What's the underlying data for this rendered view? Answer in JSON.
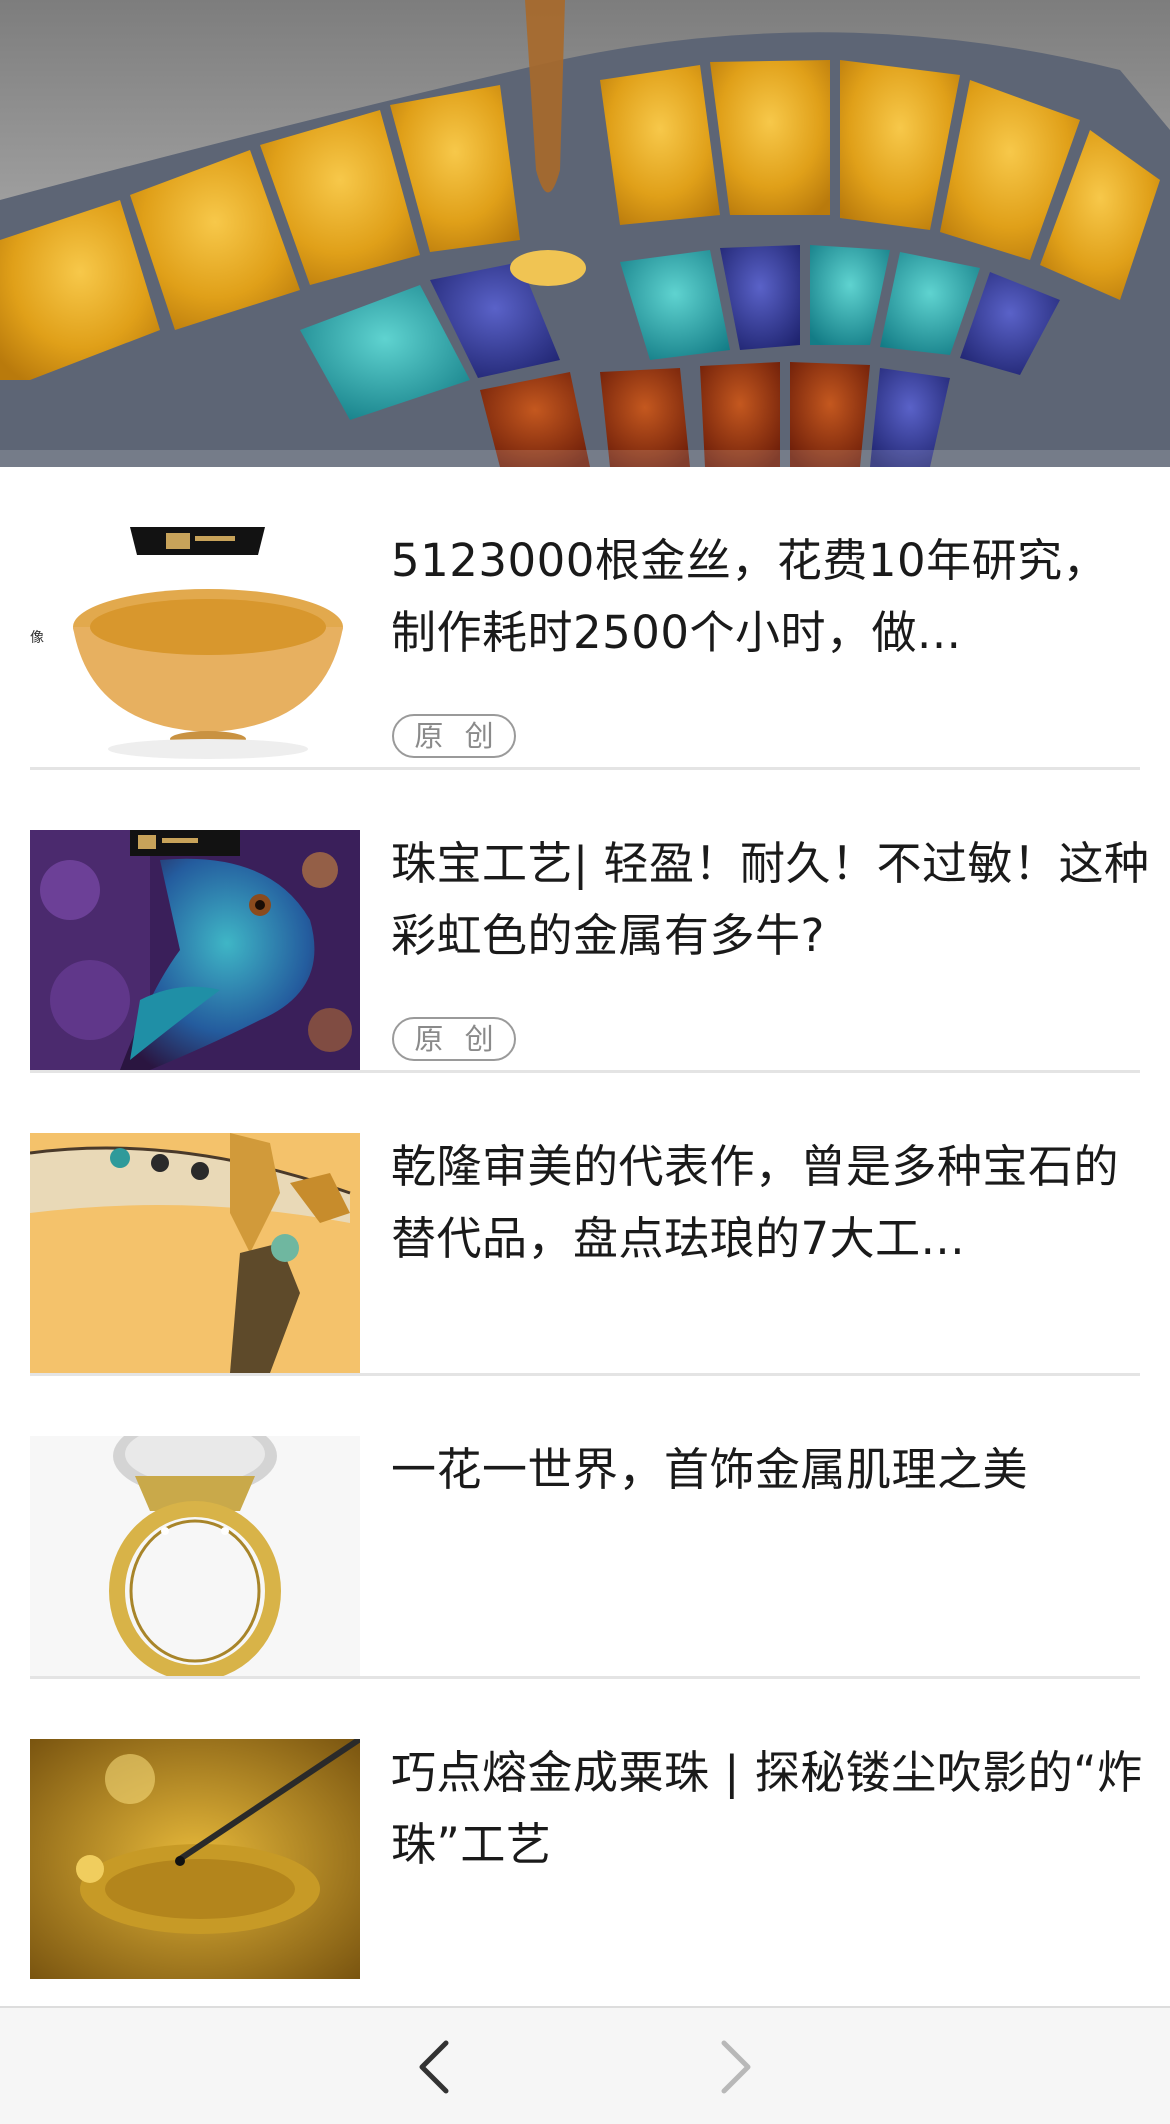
{
  "hero": {
    "image": "enamel-plique-a-jour-lotus-image"
  },
  "articles": [
    {
      "title": "5123000根金丝，花费10年研究，制作耗时2500个小时，做...",
      "badge": "原 创",
      "thumb": "gold-wire-bowl-image"
    },
    {
      "title": "珠宝工艺| 轻盈！耐久！不过敏！这种彩虹色的金属有多牛?",
      "badge": "原 创",
      "thumb": "peacock-brooch-image"
    },
    {
      "title": "乾隆审美的代表作，曾是多种宝石的替代品，盘点珐琅的7大工...",
      "badge": "",
      "thumb": "dragonfly-enamel-image"
    },
    {
      "title": "一花一世界，首饰金属肌理之美",
      "badge": "",
      "thumb": "diamond-ball-ring-image"
    },
    {
      "title": "巧点熔金成粟珠 | 探秘镂尘吹影的“炸珠”工艺",
      "badge": "",
      "thumb": "granulation-gold-image"
    }
  ],
  "nav": {
    "back_icon": "chevron-left-icon",
    "forward_icon": "chevron-right-icon"
  },
  "colors": {
    "title_text": "#1a1a1a",
    "badge_border": "#9a9a9a",
    "divider": "#e4e4e4",
    "bottom_bar": "#f6f6f6",
    "back_enabled": "#333333",
    "forward_disabled": "#b8b8b8"
  }
}
